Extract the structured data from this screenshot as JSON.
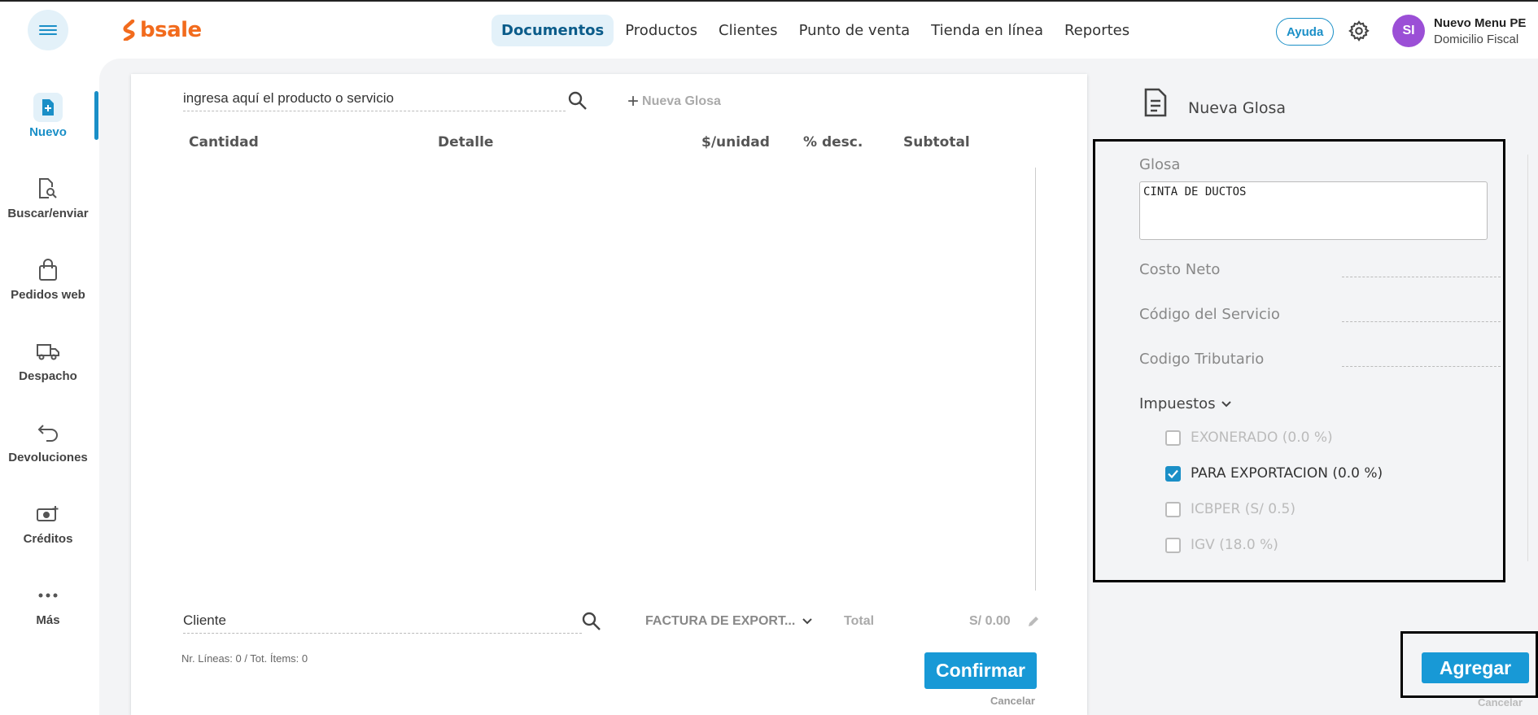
{
  "topbar": {
    "logo_text": "bsale",
    "nav": [
      {
        "label": "Documentos",
        "active": true
      },
      {
        "label": "Productos"
      },
      {
        "label": "Clientes"
      },
      {
        "label": "Punto de venta"
      },
      {
        "label": "Tienda en línea"
      },
      {
        "label": "Reportes"
      }
    ],
    "help_label": "Ayuda",
    "avatar_initials": "SI",
    "user_name": "Nuevo Menu PE",
    "user_sub": "Domicilio Fiscal"
  },
  "sidebar": {
    "items": [
      {
        "label": "Nuevo",
        "icon": "document-plus-icon",
        "active": true
      },
      {
        "label": "Buscar/enviar",
        "icon": "document-search-icon"
      },
      {
        "label": "Pedidos web",
        "icon": "shopping-bag-icon"
      },
      {
        "label": "Despacho",
        "icon": "truck-icon"
      },
      {
        "label": "Devoluciones",
        "icon": "return-arrow-icon"
      },
      {
        "label": "Créditos",
        "icon": "money-plus-icon"
      },
      {
        "label": "Más",
        "icon": "more-dots-icon"
      }
    ]
  },
  "document": {
    "search_placeholder": "ingresa aquí el producto o servicio",
    "nueva_glosa_label": "Nueva Glosa",
    "columns": [
      "Cantidad",
      "Detalle",
      "$/unidad",
      "% desc.",
      "Subtotal"
    ],
    "client_placeholder": "Cliente",
    "doc_type": "FACTURA DE EXPORT...",
    "total_label": "Total",
    "total_value": "S/ 0.00",
    "lines_info": "Nr. Líneas: 0 / Tot. Ítems: 0",
    "confirm_label": "Confirmar",
    "cancel_label": "Cancelar"
  },
  "panel": {
    "title": "Nueva Glosa",
    "glosa_label": "Glosa",
    "glosa_value": "CINTA DE DUCTOS",
    "costo_label": "Costo Neto",
    "codigo_servicio_label": "Código del Servicio",
    "codigo_tributario_label": "Codigo Tributario",
    "impuestos_label": "Impuestos",
    "taxes": [
      {
        "label": "EXONERADO (0.0 %)",
        "checked": false
      },
      {
        "label": "PARA EXPORTACION (0.0 %)",
        "checked": true
      },
      {
        "label": "ICBPER (S/ 0.5)",
        "checked": false
      },
      {
        "label": "IGV (18.0 %)",
        "checked": false
      }
    ],
    "add_label": "Agregar",
    "cancel_label": "Cancelar"
  },
  "colors": {
    "accent": "#1899d6",
    "brand": "#f26b1d",
    "avatar": "#9b4fd6"
  }
}
